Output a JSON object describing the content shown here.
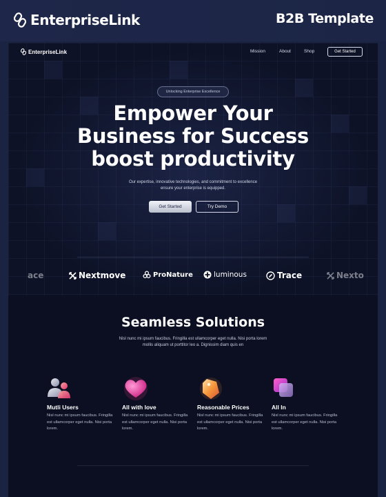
{
  "outer": {
    "brand": "EnterpriseLink",
    "tag": "B2B Template"
  },
  "nav": {
    "brand": "EnterpriseLink",
    "links": [
      "Mission",
      "About",
      "Shop"
    ],
    "cta": "Get Started"
  },
  "hero": {
    "badge": "Unlocking Enterprise Excellence",
    "title_lines": [
      "Empower Your",
      "Business for Success",
      "boost productivity"
    ],
    "subtitle": "Our expertise, innovative technologies, and commitment to excellence ensure your enterprise is equipped.",
    "primary_button": "Get Started",
    "secondary_button": "Try Demo"
  },
  "logos": [
    "ace",
    "Nextmove",
    "ProNature",
    "luminous",
    "Trace",
    "Nexto"
  ],
  "solutions": {
    "title": "Seamless Solutions",
    "subtitle": "Nisl nunc mi ipsum faucibus. Fringilla est ullamcorper eget nulla. Nisi porta lorem mollis aliquam ut porttitor leo a. Dignissim diam quis en",
    "features": [
      {
        "title": "Mutli Users",
        "desc": "Nisl nunc mi ipsum faucibus. Fringilla est ullamcorper eget nulla. Nisi porta lorem.",
        "icon": "users-icon"
      },
      {
        "title": "All with love",
        "desc": "Nisl nunc mi ipsum faucibus. Fringilla est ullamcorper eget nulla. Nisi porta lorem.",
        "icon": "heart-icon"
      },
      {
        "title": "Reasonable Prices",
        "desc": "Nisl nunc mi ipsum faucibus. Fringilla est ullamcorper eget nulla. Nisi porta lorem.",
        "icon": "price-tag-icon"
      },
      {
        "title": "All In",
        "desc": "Nisl nunc mi ipsum faucibus. Fringilla est ullamcorper eget nulla. Nisi porta lorem.",
        "icon": "layers-icon"
      }
    ]
  },
  "colors": {
    "page_bg": "#1b2342",
    "site_bg": "#0b0f21",
    "accent_pink": "#e23a8a",
    "accent_orange": "#f08a3c",
    "accent_purple": "#a468e0"
  }
}
